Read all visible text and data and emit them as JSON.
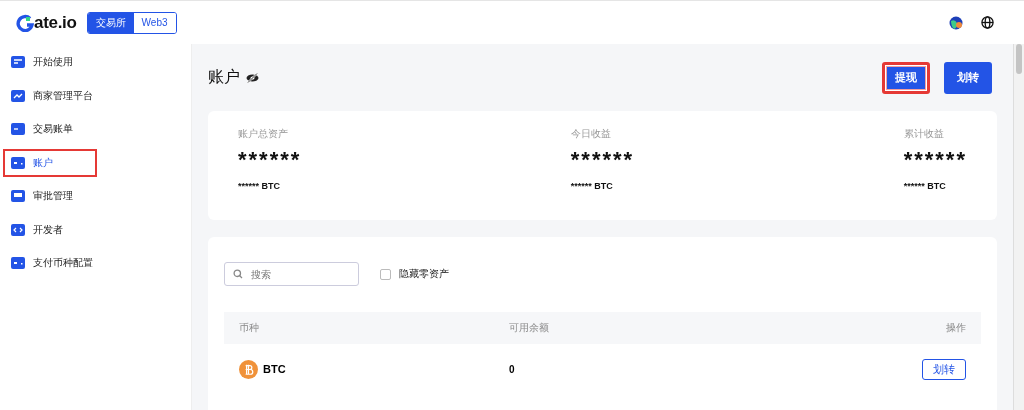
{
  "header": {
    "brand": "ate.io",
    "modes": [
      {
        "label": "交易所",
        "selected": true
      },
      {
        "label": "Web3",
        "selected": false
      }
    ]
  },
  "sidebar": {
    "items": [
      {
        "label": "开始使用",
        "selected": false,
        "highlighted": false
      },
      {
        "label": "商家管理平台",
        "selected": false,
        "highlighted": false
      },
      {
        "label": "交易账单",
        "selected": false,
        "highlighted": false
      },
      {
        "label": "账户",
        "selected": true,
        "highlighted": true
      },
      {
        "label": "审批管理",
        "selected": false,
        "highlighted": false
      },
      {
        "label": "开发者",
        "selected": false,
        "highlighted": false
      },
      {
        "label": "支付币种配置",
        "selected": false,
        "highlighted": false
      }
    ]
  },
  "page": {
    "title": "账户",
    "buttons": [
      {
        "label": "提现",
        "highlighted": true
      },
      {
        "label": "划转",
        "highlighted": false
      }
    ]
  },
  "summary": [
    {
      "label": "账户总资产",
      "value": "******",
      "sub": "****** BTC"
    },
    {
      "label": "今日收益",
      "value": "******",
      "sub": "****** BTC"
    },
    {
      "label": "累计收益",
      "value": "******",
      "sub": "****** BTC"
    }
  ],
  "filters": {
    "search": {
      "placeholder": "搜索"
    },
    "hide_zero": {
      "label": "隐藏零资产",
      "checked": false
    }
  },
  "table": {
    "columns": [
      "币种",
      "可用余额",
      "操作"
    ],
    "rows": [
      {
        "coin": "BTC",
        "balance": "0",
        "action": "划转"
      }
    ]
  }
}
